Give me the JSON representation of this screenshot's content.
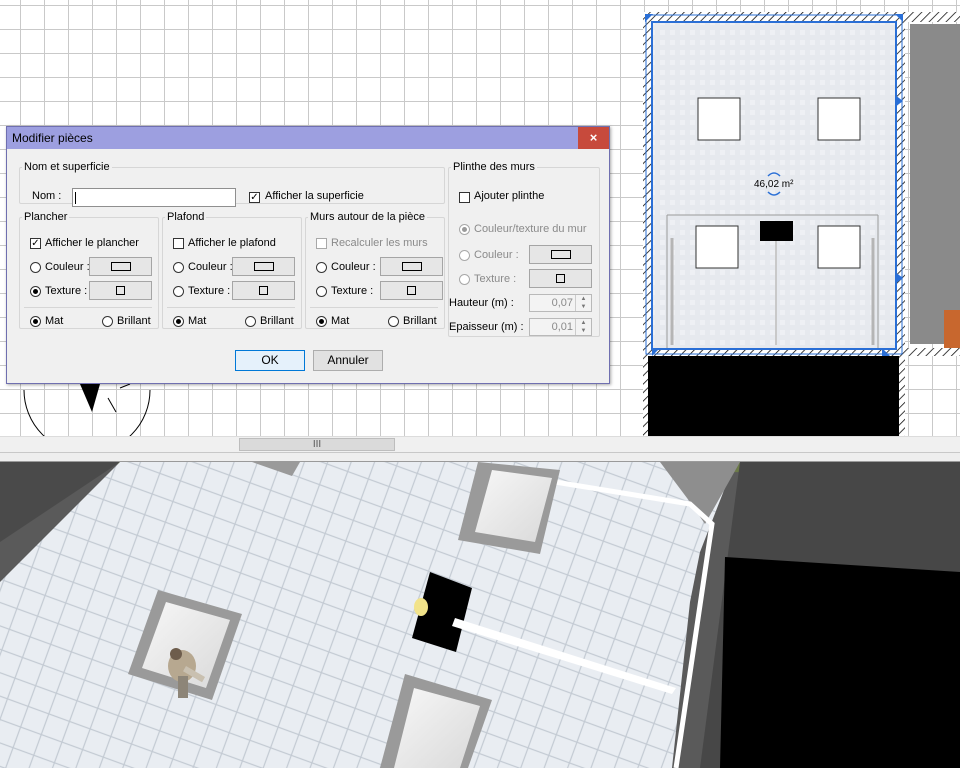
{
  "plan": {
    "area_label": "46,02 m²",
    "scroll_grip": "III"
  },
  "dialog": {
    "title": "Modifier pièces",
    "close_glyph": "×",
    "name_area": {
      "legend": "Nom et superficie",
      "name_label": "Nom :",
      "name_value": "",
      "show_area_label": "Afficher la superficie",
      "show_area_checked": true
    },
    "floor": {
      "legend": "Plancher",
      "show_label": "Afficher le plancher",
      "show_checked": true,
      "color_label": "Couleur :",
      "texture_label": "Texture :",
      "selected": "texture",
      "mat_label": "Mat",
      "shiny_label": "Brillant",
      "finish": "mat"
    },
    "ceiling": {
      "legend": "Plafond",
      "show_label": "Afficher le plafond",
      "show_checked": false,
      "color_label": "Couleur :",
      "texture_label": "Texture :",
      "mat_label": "Mat",
      "shiny_label": "Brillant",
      "finish": "mat"
    },
    "walls": {
      "legend": "Murs autour de la pièce",
      "recompute_label": "Recalculer les murs",
      "recompute_checked": false,
      "color_label": "Couleur :",
      "texture_label": "Texture :",
      "mat_label": "Mat",
      "shiny_label": "Brillant",
      "finish": "mat"
    },
    "baseboard": {
      "legend": "Plinthe des murs",
      "add_label": "Ajouter plinthe",
      "add_checked": false,
      "wall_color_label": "Couleur/texture du mur",
      "color_label": "Couleur :",
      "texture_label": "Texture :",
      "height_label": "Hauteur (m) :",
      "height_value": "0,07",
      "thickness_label": "Epaisseur (m) :",
      "thickness_value": "0,01"
    },
    "ok_label": "OK",
    "cancel_label": "Annuler"
  },
  "colors": {
    "titlebar": "#9d9fe0",
    "close": "#c74a3c",
    "selection": "#2a6fd6",
    "floor_tiles": "#e8ecf1"
  }
}
